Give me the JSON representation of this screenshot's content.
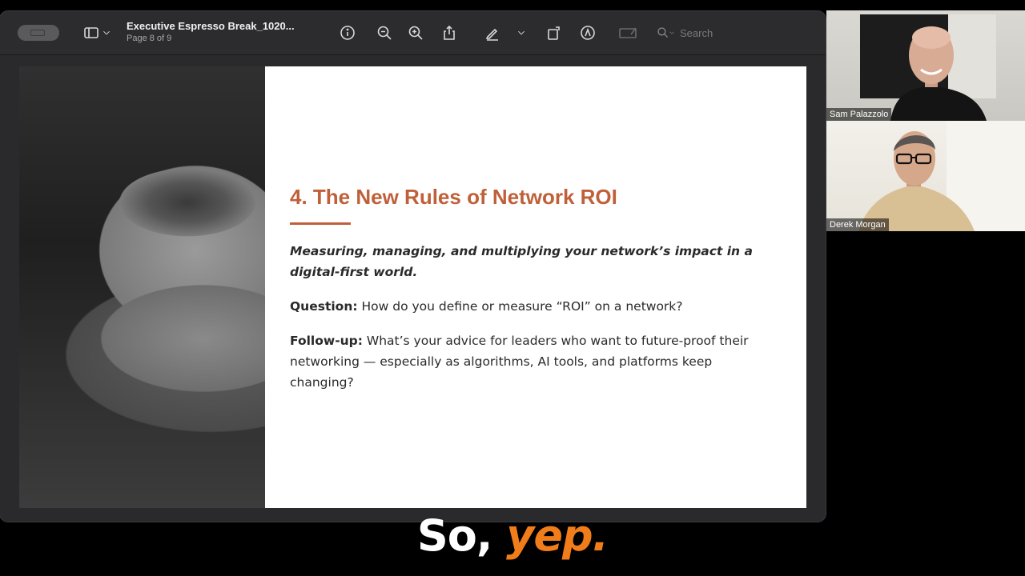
{
  "toolbar": {
    "document_title": "Executive Espresso Break_1020...",
    "page_indicator": "Page 8 of 9",
    "search_placeholder": "Search",
    "icons": [
      "sidebar-icon",
      "chevron-down-icon",
      "info-icon",
      "zoom-out-icon",
      "zoom-in-icon",
      "share-icon",
      "pen-icon",
      "chevron-down-icon",
      "rotate-icon",
      "markup-icon",
      "form-fill-icon",
      "search-icon"
    ]
  },
  "slide": {
    "title": "4. The New Rules of Network ROI",
    "lede": "Measuring, managing, and multiplying your network’s impact in a digital-first world.",
    "question_label": "Question:",
    "question_text": " How do you define or measure “ROI” on a network?",
    "followup_label": "Follow-up:",
    "followup_text": " What’s your advice for leaders who want to future-proof their networking — especially as algorithms, AI tools, and platforms keep changing?",
    "accent_color": "#c0603a"
  },
  "participants": [
    {
      "name": "Sam Palazzolo"
    },
    {
      "name": "Derek Morgan"
    }
  ],
  "caption": {
    "part1": "So,",
    "part2": "yep.",
    "highlight_color": "#f07d1a"
  }
}
